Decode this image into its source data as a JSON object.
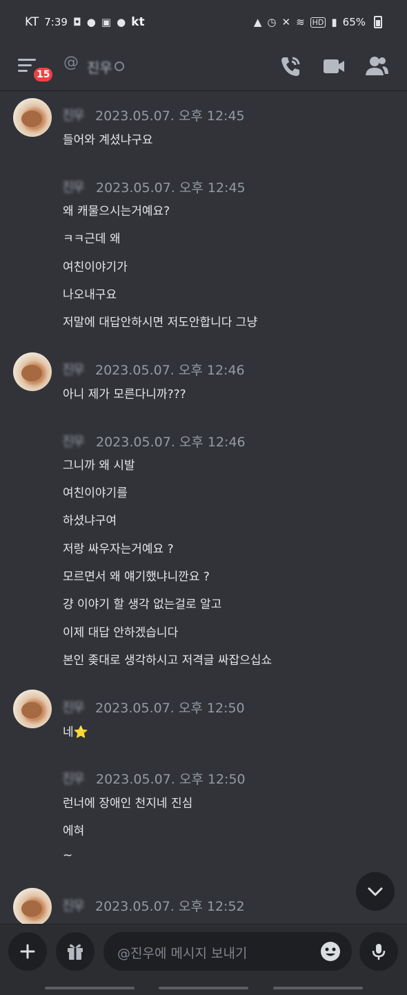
{
  "status_bar": {
    "carrier": "KT",
    "time": "7:39",
    "carrier_badge": "kt",
    "battery": "65%"
  },
  "header": {
    "badge_count": "15",
    "at_symbol": "@",
    "dm_name": "진우"
  },
  "messages": [
    {
      "author": "진우",
      "timestamp": "2023.05.07. 오후 12:45",
      "lines": [
        "들어와 계셨냐구요"
      ]
    },
    {
      "author": "진우",
      "timestamp": "2023.05.07. 오후 12:45",
      "lines": [
        "왜 캐물으시는거예요?",
        "ㅋㅋ근데 왜",
        "여친이야기가",
        "나오내구요",
        "저말에 대답안하시면 저도안합니다 그냥"
      ]
    },
    {
      "author": "진우",
      "timestamp": "2023.05.07. 오후 12:46",
      "lines": [
        "아니 제가 모른다니까???"
      ]
    },
    {
      "author": "진우",
      "timestamp": "2023.05.07. 오후 12:46",
      "lines": [
        "그니까 왜 시발",
        "여친이야기를",
        "하셨냐구여",
        "저랑 싸우자는거예요 ?",
        "모르면서 왜 얘기했냐니깐요 ?",
        "걍 이야기 할 생각 없는걸로 알고",
        "이제 대답 안하겠습니다",
        "본인 좆대로 생각하시고 저격글 싸잡으십쇼"
      ]
    },
    {
      "author": "진우",
      "timestamp": "2023.05.07. 오후 12:50",
      "lines": [
        "네⭐"
      ]
    },
    {
      "author": "진우",
      "timestamp": "2023.05.07. 오후 12:50",
      "lines": [
        "런너에 장애인 천지네 진심",
        "에혀",
        "~"
      ]
    },
    {
      "author": "진우",
      "timestamp": "2023.05.07. 오후 12:52",
      "lines": []
    }
  ],
  "composer": {
    "placeholder": "@진우에 메시지 보내기"
  },
  "icons": {
    "menu": "hamburger-menu-icon",
    "call": "phone-call-icon",
    "video": "video-camera-icon",
    "members": "member-list-icon",
    "add": "plus-icon",
    "gift": "gift-icon",
    "emoji": "emoji-icon",
    "mic": "microphone-icon",
    "scroll": "chevron-down-icon"
  }
}
